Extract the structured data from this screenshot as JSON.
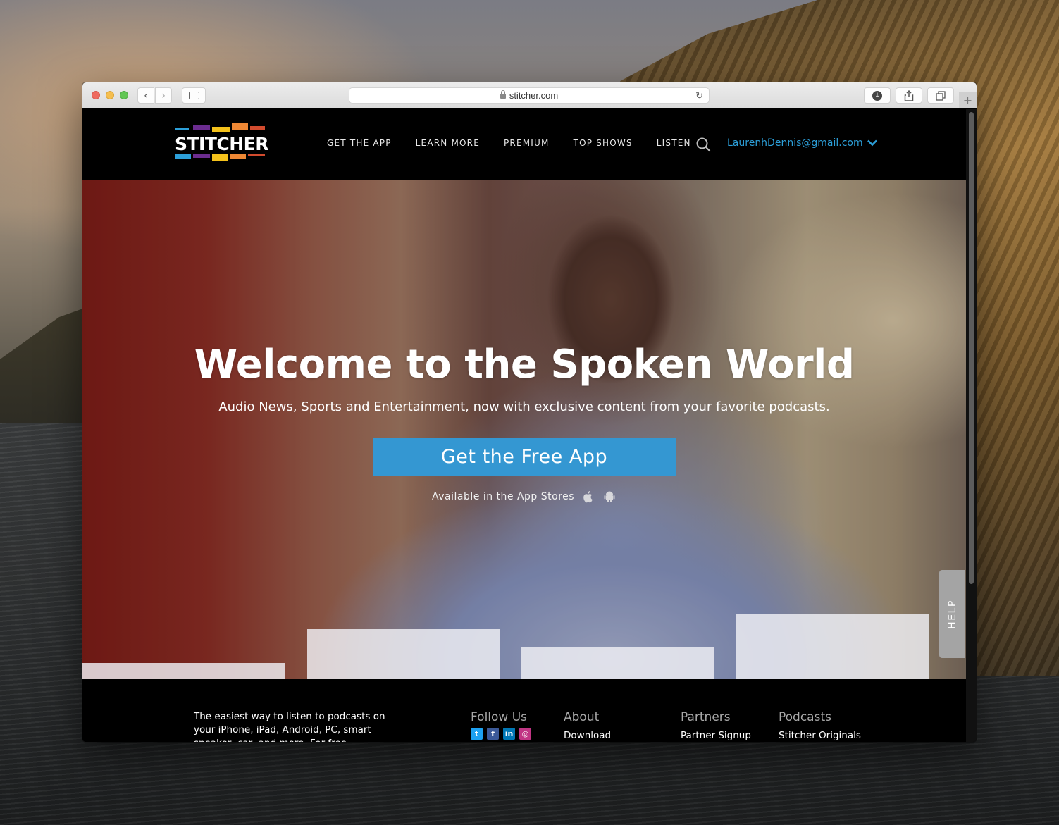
{
  "browser": {
    "url": "stitcher.com",
    "buttons": {
      "back": "‹",
      "forward": "›",
      "reload": "↻",
      "download": "↓",
      "new_tab": "+"
    }
  },
  "site": {
    "logo_text": "STITCHER",
    "brand_colors": {
      "blue": "#2c9fd9",
      "purple": "#6b2c8f",
      "yellow": "#f4c21b",
      "orange": "#ee8734",
      "red": "#d24b2e",
      "cta": "#3497d2"
    },
    "nav": [
      {
        "label": "GET THE APP"
      },
      {
        "label": "LEARN MORE"
      },
      {
        "label": "PREMIUM"
      },
      {
        "label": "TOP SHOWS"
      },
      {
        "label": "LISTEN"
      }
    ],
    "search_icon": "search-icon",
    "user_email": "LaurenhDennis@gmail.com"
  },
  "hero": {
    "title": "Welcome to the Spoken World",
    "subtitle": "Audio News, Sports and Entertainment, now with exclusive content from your favorite podcasts.",
    "cta_label": "Get the Free App",
    "availability": "Available in the App Stores",
    "store_icons": [
      "apple-icon",
      "android-icon"
    ]
  },
  "help_tab": "HELP",
  "footer": {
    "blurb": "The easiest way to listen to podcasts on your iPhone, iPad, Android, PC, smart speaker, car, and more. For free.",
    "follow_us": {
      "heading": "Follow Us",
      "icons": [
        {
          "name": "twitter-icon",
          "glyph": "t",
          "color": "#1da1f2"
        },
        {
          "name": "facebook-icon",
          "glyph": "f",
          "color": "#3b5998"
        },
        {
          "name": "linkedin-icon",
          "glyph": "in",
          "color": "#0077b5"
        },
        {
          "name": "instagram-icon",
          "glyph": "◎",
          "color": "#c13584"
        }
      ]
    },
    "columns": [
      {
        "heading": "About",
        "links": [
          "Download"
        ]
      },
      {
        "heading": "Partners",
        "links": [
          "Partner Signup"
        ]
      },
      {
        "heading": "Podcasts",
        "links": [
          "Stitcher Originals"
        ]
      }
    ]
  }
}
